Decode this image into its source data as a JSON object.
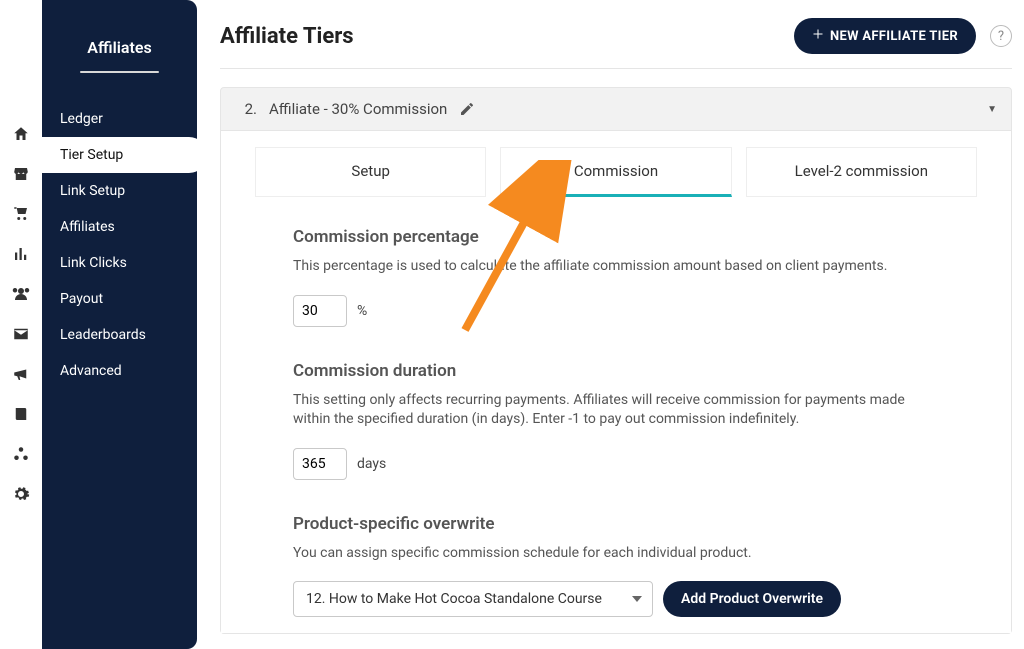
{
  "subnav": {
    "title": "Affiliates",
    "items": [
      {
        "label": "Ledger",
        "active": false
      },
      {
        "label": "Tier Setup",
        "active": true
      },
      {
        "label": "Link Setup",
        "active": false
      },
      {
        "label": "Affiliates",
        "active": false
      },
      {
        "label": "Link Clicks",
        "active": false
      },
      {
        "label": "Payout",
        "active": false
      },
      {
        "label": "Leaderboards",
        "active": false
      },
      {
        "label": "Advanced",
        "active": false
      }
    ]
  },
  "page": {
    "title": "Affiliate Tiers",
    "new_button": "NEW AFFILIATE TIER",
    "help_glyph": "?"
  },
  "accordion": {
    "index": "2.",
    "title": "Affiliate - 30% Commission"
  },
  "tabs": [
    {
      "label": "Setup",
      "active": false
    },
    {
      "label": "Commission",
      "active": true
    },
    {
      "label": "Level-2 commission",
      "active": false
    }
  ],
  "commission_percentage": {
    "title": "Commission percentage",
    "desc": "This percentage is used to calculate the affiliate commission amount based on client payments.",
    "value": "30",
    "unit": "%"
  },
  "commission_duration": {
    "title": "Commission duration",
    "desc": "This setting only affects recurring payments. Affiliates will receive commission for payments made within the specified duration (in days). Enter -1 to pay out commission indefinitely.",
    "value": "365",
    "unit": "days"
  },
  "product_overwrite": {
    "title": "Product-specific overwrite",
    "desc": "You can assign specific commission schedule for each individual product.",
    "selected": "12. How to Make Hot Cocoa Standalone Course",
    "button": "Add Product Overwrite"
  }
}
